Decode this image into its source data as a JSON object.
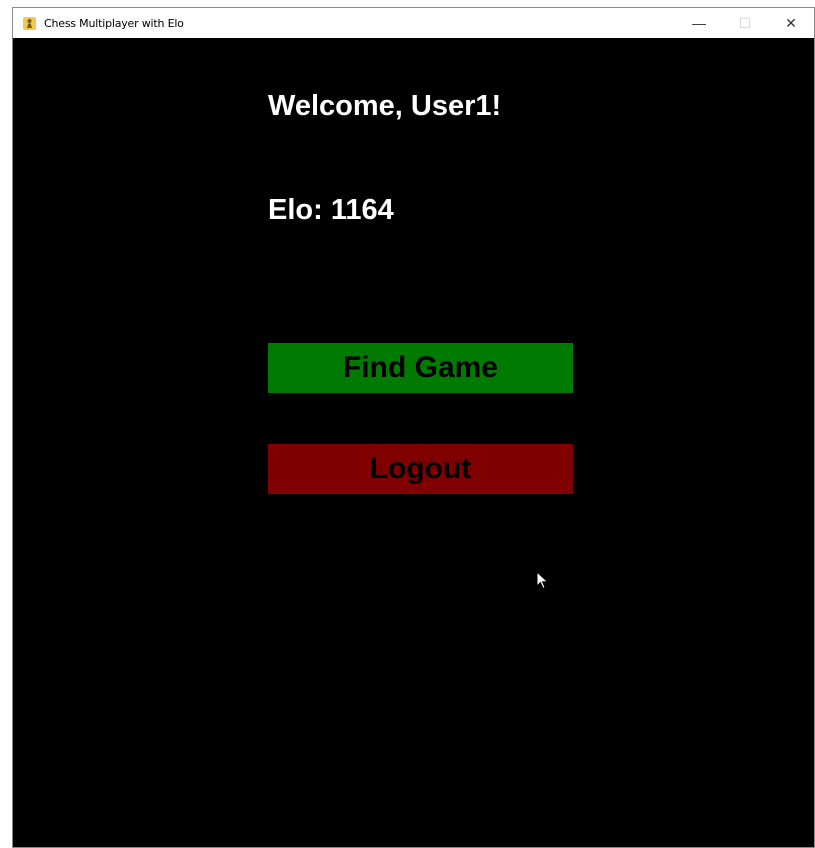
{
  "window": {
    "title": "Chess Multiplayer with Elo",
    "controls": {
      "minimize": "—",
      "maximize": "☐",
      "close": "✕"
    },
    "app_icon": "chess-pawn-icon"
  },
  "main": {
    "welcome_text": "Welcome, User1!",
    "elo_text": "Elo: 1164",
    "find_game_label": "Find Game",
    "logout_label": "Logout"
  },
  "colors": {
    "background": "#000000",
    "text": "#ffffff",
    "find_game_button": "#007a00",
    "logout_button": "#800000"
  }
}
